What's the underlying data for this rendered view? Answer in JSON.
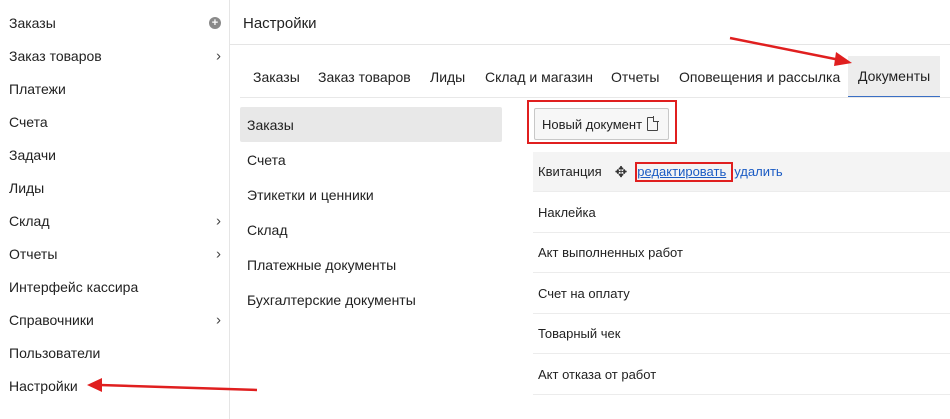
{
  "sidebar": {
    "items": [
      {
        "label": "Заказы",
        "suffix": "plus"
      },
      {
        "label": "Заказ товаров",
        "suffix": "chevron"
      },
      {
        "label": "Платежи",
        "suffix": ""
      },
      {
        "label": "Счета",
        "suffix": ""
      },
      {
        "label": "Задачи",
        "suffix": ""
      },
      {
        "label": "Лиды",
        "suffix": ""
      },
      {
        "label": "Склад",
        "suffix": "chevron"
      },
      {
        "label": "Отчеты",
        "suffix": "chevron"
      },
      {
        "label": "Интерфейс кассира",
        "suffix": ""
      },
      {
        "label": "Справочники",
        "suffix": "chevron"
      },
      {
        "label": "Пользователи",
        "suffix": ""
      },
      {
        "label": "Настройки",
        "suffix": ""
      }
    ],
    "plus_glyph": "+",
    "chevron_glyph": "›"
  },
  "header": {
    "title": "Настройки"
  },
  "tabs": [
    {
      "label": "Заказы"
    },
    {
      "label": "Заказ товаров"
    },
    {
      "label": "Лиды"
    },
    {
      "label": "Склад и магазин"
    },
    {
      "label": "Отчеты"
    },
    {
      "label": "Оповещения и рассылка"
    },
    {
      "label": "Документы",
      "active": true
    }
  ],
  "categories": [
    {
      "label": "Заказы",
      "active": true
    },
    {
      "label": "Счета"
    },
    {
      "label": "Этикетки и ценники"
    },
    {
      "label": "Склад"
    },
    {
      "label": "Платежные документы"
    },
    {
      "label": "Бухгалтерские документы"
    }
  ],
  "new_document": {
    "label": "Новый документ",
    "icon": "file-icon"
  },
  "documents": [
    {
      "name": "Квитанция",
      "edit_label": "редактировать",
      "delete_label": "удалить",
      "move_glyph": "✥"
    },
    {
      "name": "Наклейка"
    },
    {
      "name": "Акт выполненных работ"
    },
    {
      "name": "Счет на оплату"
    },
    {
      "name": "Товарный чек"
    },
    {
      "name": "Акт отказа от работ"
    }
  ],
  "colors": {
    "accent": "#1a5bc4",
    "annotation": "#e01f1f",
    "active_tab_border": "#3a6fc4"
  }
}
